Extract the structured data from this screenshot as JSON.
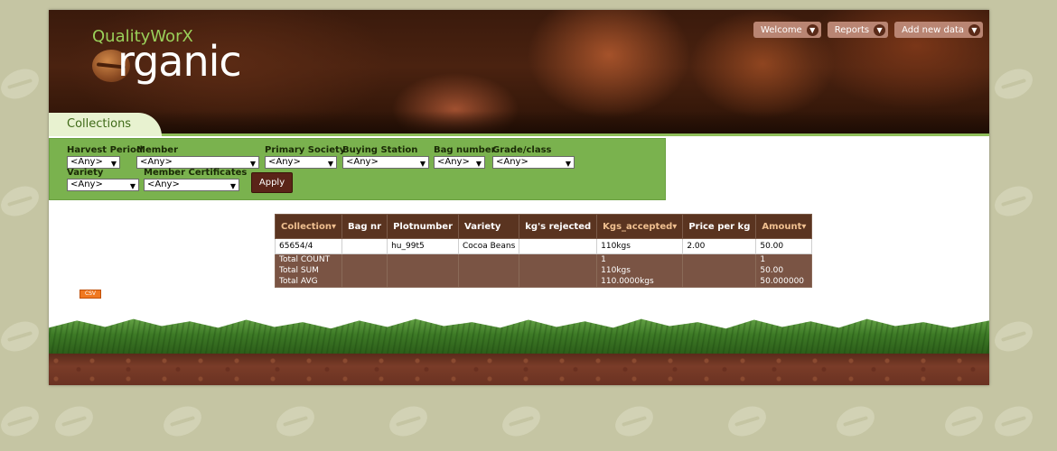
{
  "brand": {
    "top": "QualityWorX",
    "main": "rganic"
  },
  "nav": [
    {
      "label": "Welcome",
      "icon": "chevron-down-icon"
    },
    {
      "label": "Reports",
      "icon": "chevron-down-icon"
    },
    {
      "label": "Add new data",
      "icon": "chevron-down-icon"
    }
  ],
  "tab": {
    "label": "Collections"
  },
  "filters": {
    "harvest_period": {
      "label": "Harvest Period",
      "value": "<Any>"
    },
    "member": {
      "label": "Member",
      "value": "<Any>"
    },
    "primary_society": {
      "label": "Primary Society",
      "value": "<Any>"
    },
    "buying_station": {
      "label": "Buying Station",
      "value": "<Any>"
    },
    "bag_number": {
      "label": "Bag number",
      "value": "<Any>"
    },
    "grade_class": {
      "label": "Grade/class",
      "value": "<Any>"
    },
    "variety": {
      "label": "Variety",
      "value": "<Any>"
    },
    "member_certificates": {
      "label": "Member Certificates",
      "value": "<Any>"
    },
    "apply_label": "Apply"
  },
  "table": {
    "columns": [
      {
        "label": "Collection",
        "sortable": true
      },
      {
        "label": "Bag nr",
        "sortable": false
      },
      {
        "label": "Plotnumber",
        "sortable": false
      },
      {
        "label": "Variety",
        "sortable": false
      },
      {
        "label": "kg's rejected",
        "sortable": false
      },
      {
        "label": "Kgs_accepted",
        "sortable": true
      },
      {
        "label": "Price per kg",
        "sortable": false
      },
      {
        "label": "Amount",
        "sortable": true
      }
    ],
    "rows": [
      [
        "65654/4",
        "",
        "hu_99t5",
        "Cocoa Beans",
        "",
        "110kgs",
        "2.00",
        "50.00"
      ]
    ],
    "totals": {
      "labels": [
        "Total COUNT",
        "Total SUM",
        "Total AVG"
      ],
      "kgs_accepted": [
        "1",
        "110kgs",
        "110.0000kgs"
      ],
      "amount": [
        "1",
        "50.00",
        "50.000000"
      ]
    },
    "sort_arrow": "▾"
  },
  "csv_label": "CSV",
  "colors": {
    "page_bg": "#c5c5a3",
    "filter_green": "#7ab24e",
    "table_header": "#5a3420",
    "totals_bg": "#7a5444",
    "csv_orange": "#f07820"
  }
}
